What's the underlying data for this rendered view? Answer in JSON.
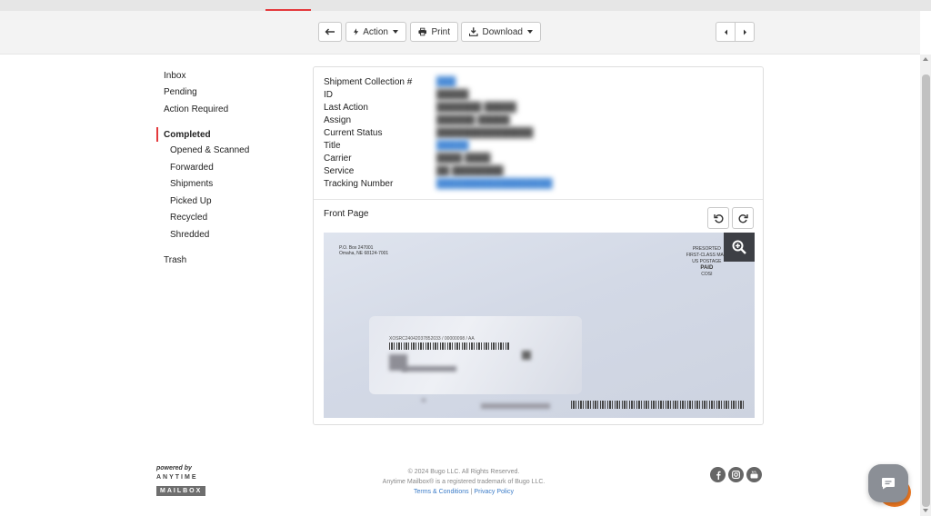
{
  "toolbar": {
    "action_label": "Action",
    "print_label": "Print",
    "download_label": "Download"
  },
  "sidebar": {
    "items": [
      {
        "label": "Inbox"
      },
      {
        "label": "Pending"
      },
      {
        "label": "Action Required"
      },
      {
        "label": "Completed"
      },
      {
        "label": "Opened & Scanned"
      },
      {
        "label": "Forwarded"
      },
      {
        "label": "Shipments"
      },
      {
        "label": "Picked Up"
      },
      {
        "label": "Recycled"
      },
      {
        "label": "Shredded"
      },
      {
        "label": "Trash"
      }
    ]
  },
  "details": {
    "fields": [
      {
        "label": "Shipment Collection #",
        "value": "███"
      },
      {
        "label": "ID",
        "value": "█████"
      },
      {
        "label": "Last Action",
        "value": "███████ █████"
      },
      {
        "label": "Assign",
        "value": "██████ █████"
      },
      {
        "label": "Current Status",
        "value": "███████████████"
      },
      {
        "label": "Title",
        "value": "█████"
      },
      {
        "label": "Carrier",
        "value": "████ ████"
      },
      {
        "label": "Service",
        "value": "██ ████████"
      },
      {
        "label": "Tracking Number",
        "value": "██████████████████"
      }
    ],
    "front_page_label": "Front Page"
  },
  "envelope": {
    "return_address_line1": "P.O. Box 247001",
    "return_address_line2": "Omaha, NE 68124-7001",
    "postage_line1": "PRESORTED",
    "postage_line2": "FIRST-CLASS MAIL",
    "postage_line3": "US POSTAGE",
    "postage_line4": "PAID",
    "postage_line5": "COSI",
    "barcode_text": "XOSRC24042037852033 / 00000098 / AA"
  },
  "footer": {
    "powered_by": "powered by",
    "brand_top": "ANYTIME",
    "brand_bottom": "MAILBOX",
    "copyright": "© 2024 Bugo LLC. All Rights Reserved.",
    "trademark": "Anytime Mailbox® is a registered trademark of Bugo LLC.",
    "terms_link": "Terms & Conditions",
    "separator": "|",
    "privacy_link": "Privacy Policy"
  },
  "colors": {
    "accent": "#e4393c",
    "link": "#3a7bc8",
    "chat_orange": "#f07a22"
  },
  "icons": {
    "back": "arrow-left-icon",
    "action": "lightning-icon",
    "print": "printer-icon",
    "download": "download-icon",
    "prev": "chevron-left-icon",
    "next": "chevron-right-icon",
    "rotate_left": "rotate-left-icon",
    "rotate_right": "rotate-right-icon",
    "zoom": "zoom-in-icon",
    "facebook": "facebook-icon",
    "instagram": "instagram-icon",
    "youtube": "youtube-icon",
    "chat": "chat-icon"
  }
}
